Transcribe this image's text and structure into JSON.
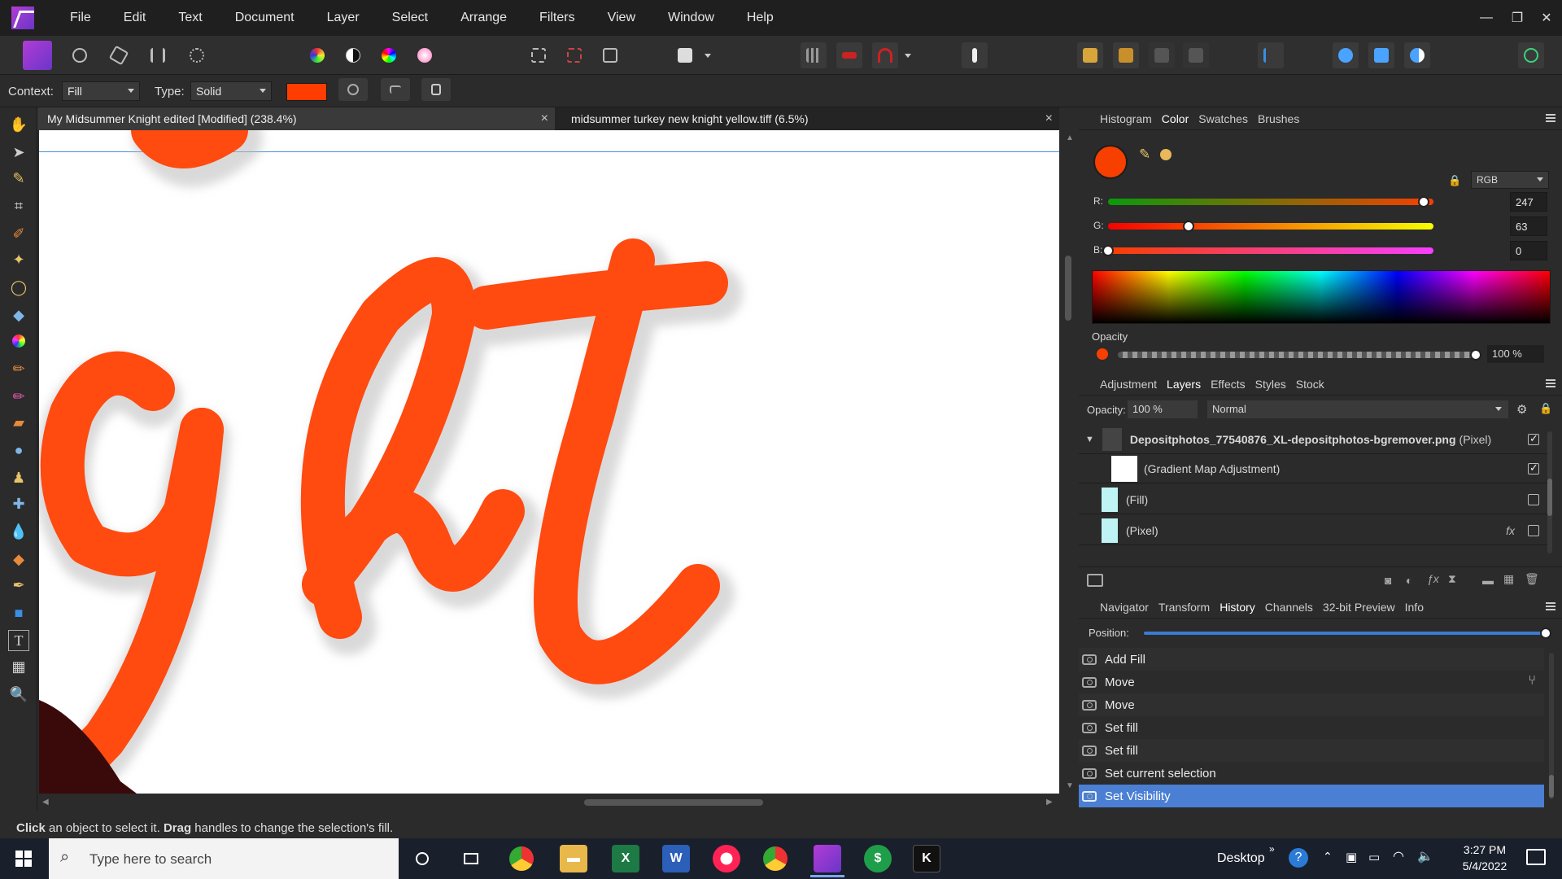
{
  "menu": {
    "items": [
      "File",
      "Edit",
      "Text",
      "Document",
      "Layer",
      "Select",
      "Arrange",
      "Filters",
      "View",
      "Window",
      "Help"
    ]
  },
  "context_bar": {
    "context_label": "Context:",
    "context_value": "Fill",
    "type_label": "Type:",
    "type_value": "Solid",
    "fill_color": "#ff3d00"
  },
  "documents": {
    "tabs": [
      {
        "title": "My Midsummer Knight edited [Modified] (238.4%)",
        "close": "×"
      },
      {
        "title": "midsummer turkey new knight yellow.tiff (6.5%)",
        "close": "×"
      }
    ]
  },
  "canvas": {
    "art_text": "ght",
    "art_color": "#ff4a10"
  },
  "color_panel": {
    "tabs": [
      "Histogram",
      "Color",
      "Swatches",
      "Brushes"
    ],
    "active_tab": "Color",
    "model": "RGB",
    "swatch_color": "#f73f00",
    "r_label": "R:",
    "g_label": "G:",
    "b_label": "B:",
    "r_value": "247",
    "g_value": "63",
    "b_value": "0",
    "r_fraction": 0.969,
    "g_fraction": 0.247,
    "b_fraction": 0.0,
    "opacity_label": "Opacity",
    "opacity_value": "100 %",
    "opacity_fraction": 1.0
  },
  "layers_panel": {
    "tabs": [
      "Adjustment",
      "Layers",
      "Effects",
      "Styles",
      "Stock"
    ],
    "active_tab": "Layers",
    "opacity_label": "Opacity:",
    "opacity_value": "100 %",
    "blend_mode": "Normal",
    "layers": [
      {
        "name": "Depositphotos_77540876_XL-depositphotos-bgremover.png",
        "kind": "(Pixel)",
        "visible": true
      },
      {
        "name": "(Gradient Map Adjustment)",
        "kind": "",
        "visible": true
      },
      {
        "name": "(Fill)",
        "kind": "",
        "visible": false
      },
      {
        "name": "(Pixel)",
        "kind": "",
        "visible": false,
        "fx": "fx"
      }
    ]
  },
  "history_panel": {
    "tabs": [
      "Navigator",
      "Transform",
      "History",
      "Channels",
      "32-bit Preview",
      "Info"
    ],
    "active_tab": "History",
    "position_label": "Position:",
    "position_fraction": 1.0,
    "items": [
      "Add Fill",
      "Move",
      "Move",
      "Set fill",
      "Set fill",
      "Set current selection",
      "Set Visibility"
    ],
    "selected_item": "Set Visibility"
  },
  "status": {
    "bold1": "Click",
    "text1": " an object to select it. ",
    "bold2": "Drag",
    "text2": " handles to change the selection's fill."
  },
  "taskbar": {
    "search_placeholder": "Type here to search",
    "desktop_label": "Desktop",
    "time": "3:27 PM",
    "date": "5/4/2022"
  }
}
